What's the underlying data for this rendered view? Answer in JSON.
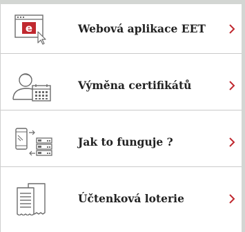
{
  "menu": {
    "items": [
      {
        "label": "Webová aplikace EET",
        "icon": "web-app-icon"
      },
      {
        "label": "Výměna certifikátů",
        "icon": "certificate-user-icon"
      },
      {
        "label": "Jak to funguje ?",
        "icon": "device-server-icon"
      },
      {
        "label": "Účtenková loterie",
        "icon": "receipts-icon"
      }
    ]
  },
  "colors": {
    "accent": "#c0282f",
    "line": "#6b6b6b",
    "separator": "#c9c9c9",
    "text": "#222222"
  }
}
